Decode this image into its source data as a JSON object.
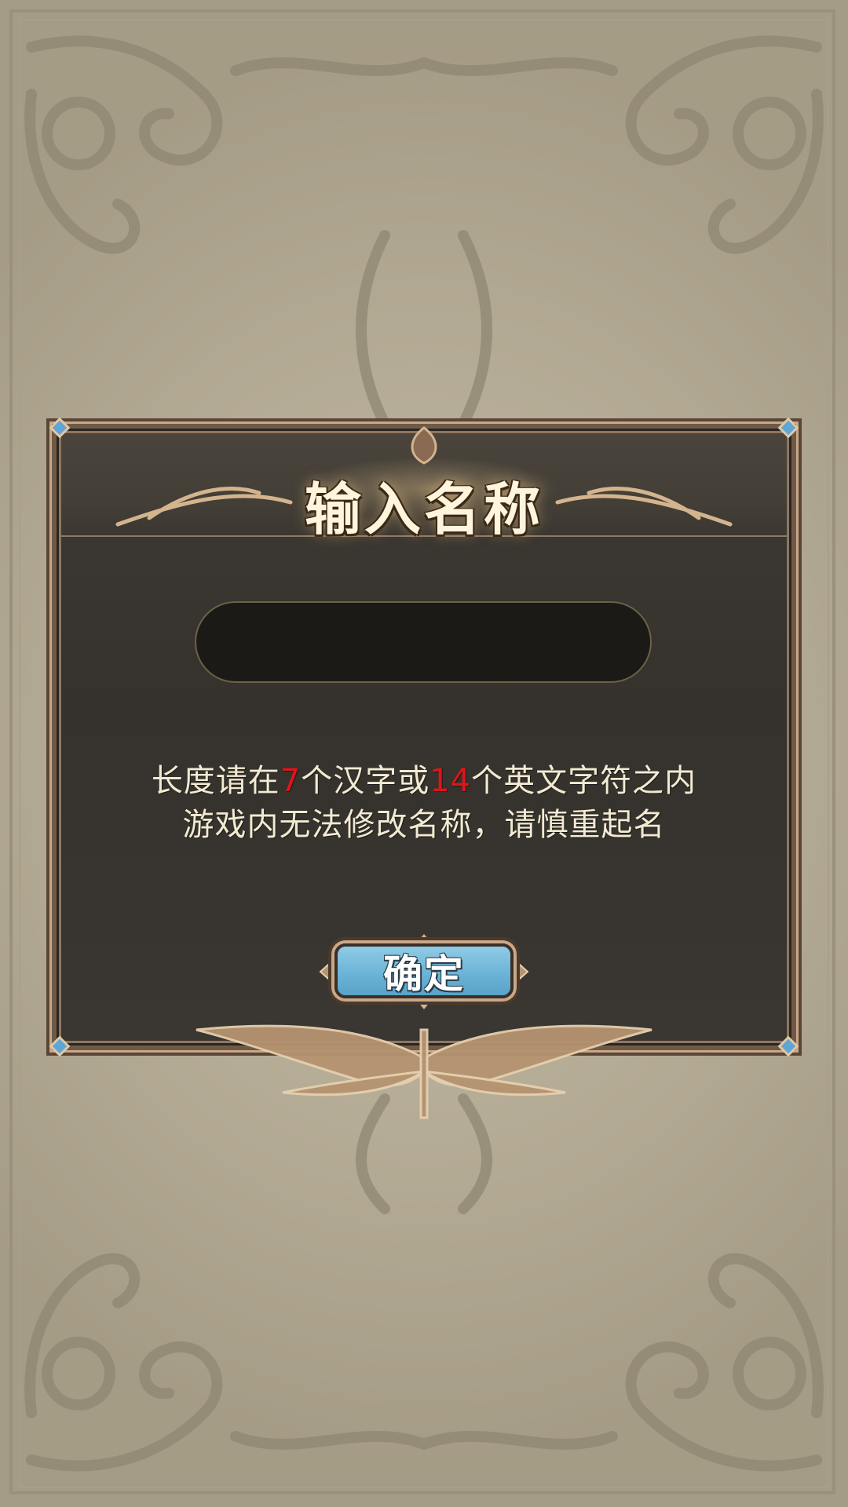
{
  "dialog": {
    "title": "输入名称",
    "name_input": {
      "value": "",
      "placeholder": ""
    },
    "hint_line1": {
      "part1": "长度请在",
      "cn_limit": "7",
      "part2": "个汉字或",
      "en_limit": "14",
      "part3": "个英文字符之内"
    },
    "hint_line2": "游戏内无法修改名称，请慎重起名",
    "confirm_label": "确定"
  },
  "colors": {
    "background": "#b6ad98",
    "dialog_bg": "#3a3631",
    "frame_gold": "#c9a888",
    "hint_text": "#f2ead2",
    "highlight_red": "#e0141a",
    "button_blue": "#69b2d6"
  }
}
